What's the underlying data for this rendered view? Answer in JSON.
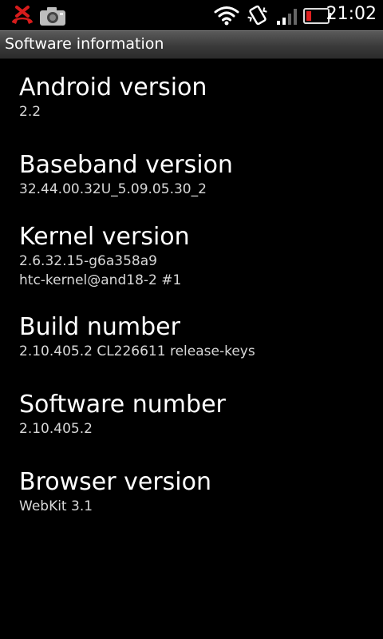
{
  "status_bar": {
    "time": "21:02",
    "icons": [
      "missed-call-icon",
      "camera-icon",
      "wifi-icon",
      "vibrate-icon",
      "signal-icon",
      "battery-low-icon"
    ]
  },
  "title_bar": {
    "title": "Software information"
  },
  "items": [
    {
      "label": "Android version",
      "values": [
        "2.2"
      ]
    },
    {
      "label": "Baseband version",
      "values": [
        "32.44.00.32U_5.09.05.30_2"
      ]
    },
    {
      "label": "Kernel version",
      "values": [
        "2.6.32.15-g6a358a9",
        "htc-kernel@and18-2 #1"
      ]
    },
    {
      "label": "Build number",
      "values": [
        "2.10.405.2 CL226611 release-keys"
      ]
    },
    {
      "label": "Software number",
      "values": [
        "2.10.405.2"
      ]
    },
    {
      "label": "Browser version",
      "values": [
        "WebKit 3.1"
      ]
    }
  ],
  "colors": {
    "background": "#000000",
    "battery_low": "#e02020",
    "missed_call": "#e02020"
  }
}
